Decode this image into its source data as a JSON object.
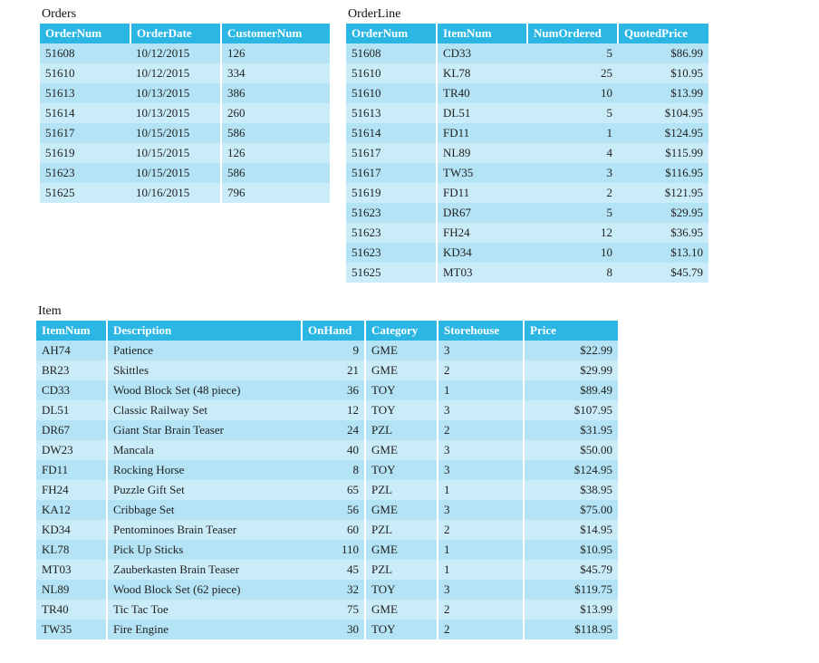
{
  "orders": {
    "title": "Orders",
    "headers": [
      "OrderNum",
      "OrderDate",
      "CustomerNum"
    ],
    "rows": [
      {
        "num": "51608",
        "date": "10/12/2015",
        "cust": "126"
      },
      {
        "num": "51610",
        "date": "10/12/2015",
        "cust": "334"
      },
      {
        "num": "51613",
        "date": "10/13/2015",
        "cust": "386"
      },
      {
        "num": "51614",
        "date": "10/13/2015",
        "cust": "260"
      },
      {
        "num": "51617",
        "date": "10/15/2015",
        "cust": "586"
      },
      {
        "num": "51619",
        "date": "10/15/2015",
        "cust": "126"
      },
      {
        "num": "51623",
        "date": "10/15/2015",
        "cust": "586"
      },
      {
        "num": "51625",
        "date": "10/16/2015",
        "cust": "796"
      }
    ]
  },
  "orderline": {
    "title": "OrderLine",
    "headers": [
      "OrderNum",
      "ItemNum",
      "NumOrdered",
      "QuotedPrice"
    ],
    "rows": [
      {
        "order": "51608",
        "item": "CD33",
        "qty": "5",
        "price": "$86.99"
      },
      {
        "order": "51610",
        "item": "KL78",
        "qty": "25",
        "price": "$10.95"
      },
      {
        "order": "51610",
        "item": "TR40",
        "qty": "10",
        "price": "$13.99"
      },
      {
        "order": "51613",
        "item": "DL51",
        "qty": "5",
        "price": "$104.95"
      },
      {
        "order": "51614",
        "item": "FD11",
        "qty": "1",
        "price": "$124.95"
      },
      {
        "order": "51617",
        "item": "NL89",
        "qty": "4",
        "price": "$115.99"
      },
      {
        "order": "51617",
        "item": "TW35",
        "qty": "3",
        "price": "$116.95"
      },
      {
        "order": "51619",
        "item": "FD11",
        "qty": "2",
        "price": "$121.95"
      },
      {
        "order": "51623",
        "item": "DR67",
        "qty": "5",
        "price": "$29.95"
      },
      {
        "order": "51623",
        "item": "FH24",
        "qty": "12",
        "price": "$36.95"
      },
      {
        "order": "51623",
        "item": "KD34",
        "qty": "10",
        "price": "$13.10"
      },
      {
        "order": "51625",
        "item": "MT03",
        "qty": "8",
        "price": "$45.79"
      }
    ]
  },
  "item": {
    "title": "Item",
    "headers": [
      "ItemNum",
      "Description",
      "OnHand",
      "Category",
      "Storehouse",
      "Price"
    ],
    "rows": [
      {
        "num": "AH74",
        "desc": "Patience",
        "onhand": "9",
        "cat": "GME",
        "store": "3",
        "price": "$22.99"
      },
      {
        "num": "BR23",
        "desc": "Skittles",
        "onhand": "21",
        "cat": "GME",
        "store": "2",
        "price": "$29.99"
      },
      {
        "num": "CD33",
        "desc": "Wood Block Set (48 piece)",
        "onhand": "36",
        "cat": "TOY",
        "store": "1",
        "price": "$89.49"
      },
      {
        "num": "DL51",
        "desc": "Classic Railway Set",
        "onhand": "12",
        "cat": "TOY",
        "store": "3",
        "price": "$107.95"
      },
      {
        "num": "DR67",
        "desc": "Giant Star Brain Teaser",
        "onhand": "24",
        "cat": "PZL",
        "store": "2",
        "price": "$31.95"
      },
      {
        "num": "DW23",
        "desc": "Mancala",
        "onhand": "40",
        "cat": "GME",
        "store": "3",
        "price": "$50.00"
      },
      {
        "num": "FD11",
        "desc": "Rocking Horse",
        "onhand": "8",
        "cat": "TOY",
        "store": "3",
        "price": "$124.95"
      },
      {
        "num": "FH24",
        "desc": "Puzzle Gift Set",
        "onhand": "65",
        "cat": "PZL",
        "store": "1",
        "price": "$38.95"
      },
      {
        "num": "KA12",
        "desc": "Cribbage Set",
        "onhand": "56",
        "cat": "GME",
        "store": "3",
        "price": "$75.00"
      },
      {
        "num": "KD34",
        "desc": "Pentominoes Brain Teaser",
        "onhand": "60",
        "cat": "PZL",
        "store": "2",
        "price": "$14.95"
      },
      {
        "num": "KL78",
        "desc": "Pick Up Sticks",
        "onhand": "110",
        "cat": "GME",
        "store": "1",
        "price": "$10.95"
      },
      {
        "num": "MT03",
        "desc": "Zauberkasten Brain Teaser",
        "onhand": "45",
        "cat": "PZL",
        "store": "1",
        "price": "$45.79"
      },
      {
        "num": "NL89",
        "desc": "Wood Block Set (62 piece)",
        "onhand": "32",
        "cat": "TOY",
        "store": "3",
        "price": "$119.75"
      },
      {
        "num": "TR40",
        "desc": "Tic Tac Toe",
        "onhand": "75",
        "cat": "GME",
        "store": "2",
        "price": "$13.99"
      },
      {
        "num": "TW35",
        "desc": "Fire Engine",
        "onhand": "30",
        "cat": "TOY",
        "store": "2",
        "price": "$118.95"
      }
    ]
  }
}
